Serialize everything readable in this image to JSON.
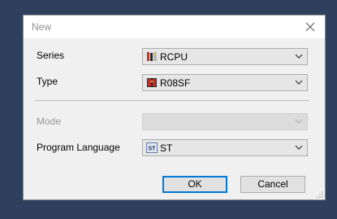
{
  "window": {
    "title": "New"
  },
  "fields": {
    "series": {
      "label": "Series",
      "value": "RCPU",
      "icon": "rcpu-module-icon"
    },
    "type": {
      "label": "Type",
      "value": "R08SF",
      "icon": "r08sf-module-icon"
    },
    "mode": {
      "label": "Mode",
      "value": "",
      "disabled": true
    },
    "program_language": {
      "label": "Program Language",
      "value": "ST",
      "icon_text": "ST"
    }
  },
  "buttons": {
    "ok": "OK",
    "cancel": "Cancel"
  },
  "colors": {
    "default_button_border": "#0078d7",
    "backdrop": "#2f3f5e"
  }
}
